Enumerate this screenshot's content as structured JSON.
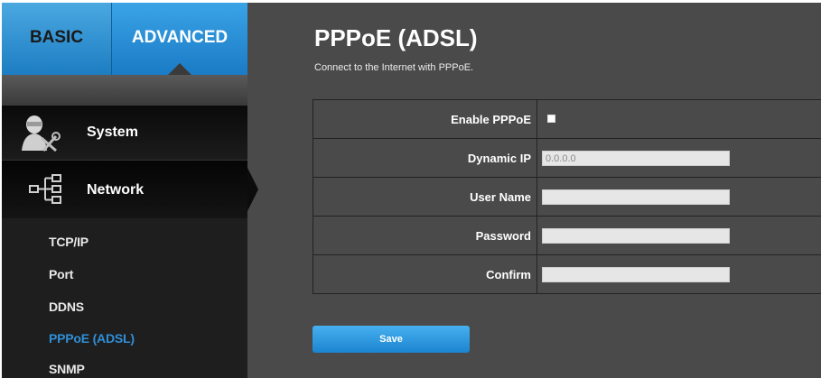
{
  "tabs": {
    "basic": "BASIC",
    "advanced": "ADVANCED"
  },
  "menu": {
    "system": {
      "label": "System",
      "icon": "system-settings-icon"
    },
    "network": {
      "label": "Network",
      "icon": "network-tree-icon"
    },
    "submenu": [
      "TCP/IP",
      "Port",
      "DDNS",
      "PPPoE (ADSL)",
      "SNMP"
    ],
    "active_submenu": "PPPoE (ADSL)"
  },
  "page": {
    "title": "PPPoE (ADSL)",
    "description": "Connect to the Internet with PPPoE."
  },
  "form": {
    "enable_label": "Enable PPPoE",
    "dynamic_ip_label": "Dynamic IP",
    "dynamic_ip_value": "0.0.0.0",
    "username_label": "User Name",
    "username_value": "",
    "password_label": "Password",
    "password_value": "",
    "confirm_label": "Confirm",
    "confirm_value": ""
  },
  "actions": {
    "save": "Save"
  },
  "colors": {
    "accent": "#1b84cf",
    "active_submenu": "#2f8fd8",
    "panel": "#4a4a4a",
    "sidebar": "#1e1e1e"
  }
}
